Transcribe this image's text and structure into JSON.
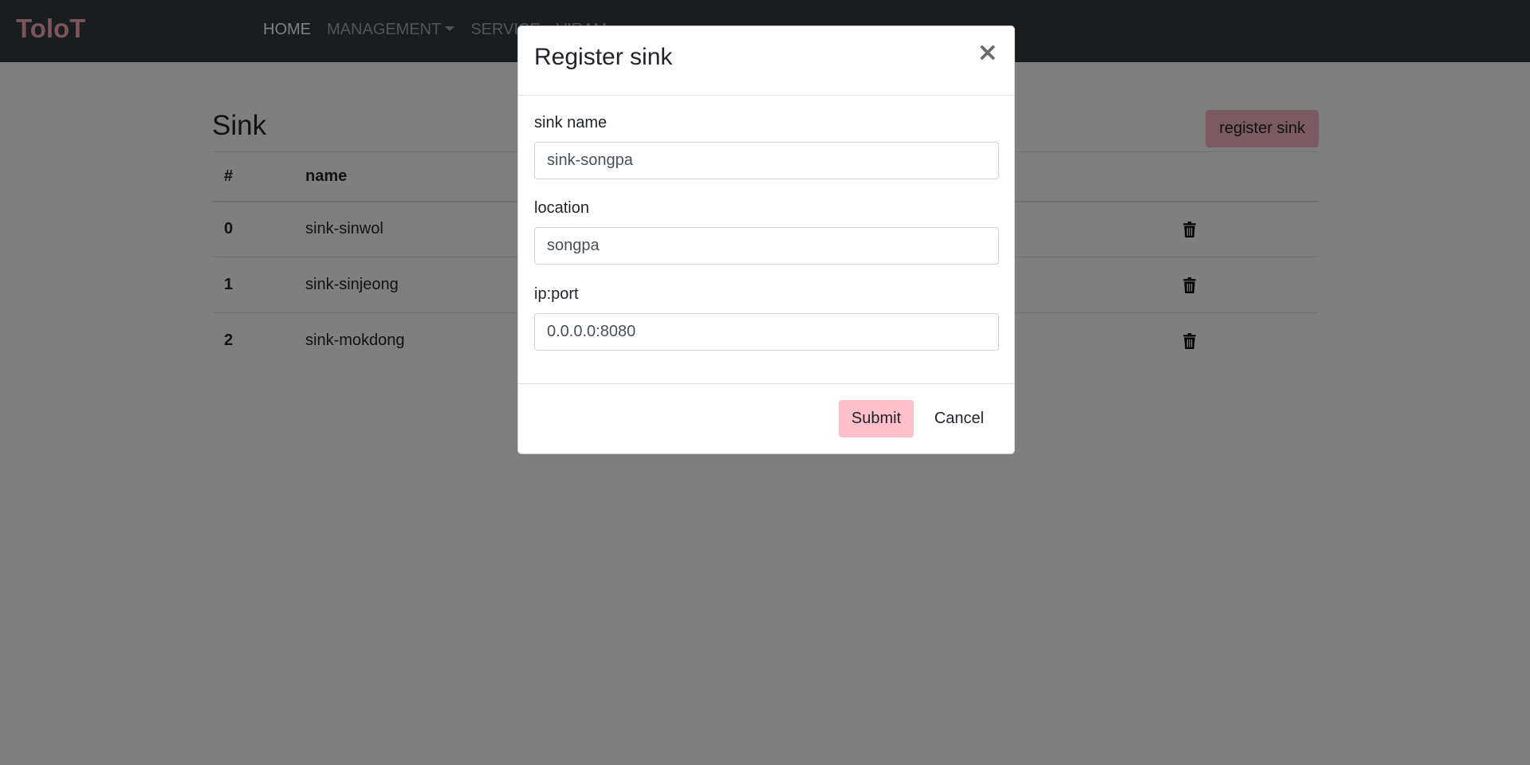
{
  "app": {
    "brand": "ToloT",
    "colors": {
      "brand": "#f7a8b8",
      "navbar_bg": "#343a40",
      "accent_button": "#ffc0cb"
    }
  },
  "nav": {
    "items": [
      {
        "label": "HOME",
        "active": true
      },
      {
        "label": "MANAGEMENT",
        "dropdown": true
      },
      {
        "label": "SERVICE"
      },
      {
        "label": "VIRAM"
      }
    ]
  },
  "page": {
    "title": "Sink",
    "register_label": "register sink",
    "table": {
      "headers": [
        "#",
        "name"
      ],
      "rows": [
        {
          "index": "0",
          "name": "sink-sinwol",
          "action_icon": "trash-icon"
        },
        {
          "index": "1",
          "name": "sink-sinjeong",
          "action_icon": "trash-icon"
        },
        {
          "index": "2",
          "name": "sink-mokdong",
          "action_icon": "trash-icon"
        }
      ]
    }
  },
  "modal": {
    "title": "Register sink",
    "close_icon": "×",
    "fields": [
      {
        "label": "sink name",
        "value": "sink-songpa"
      },
      {
        "label": "location",
        "value": "songpa"
      },
      {
        "label": "ip:port",
        "value": "0.0.0.0:8080"
      }
    ],
    "submit_label": "Submit",
    "cancel_label": "Cancel"
  }
}
